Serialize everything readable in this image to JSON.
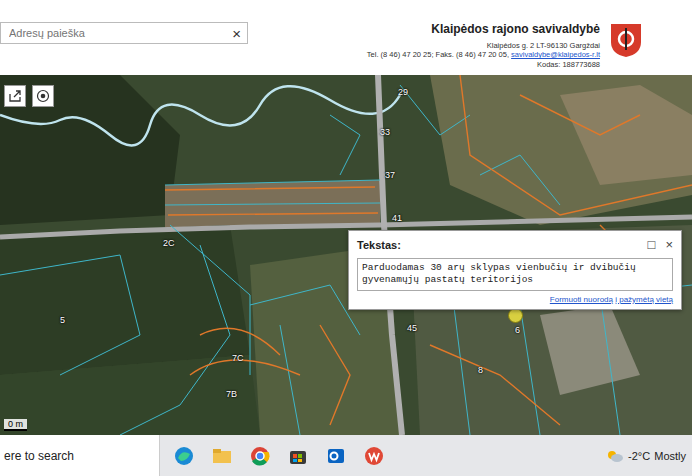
{
  "header": {
    "search": {
      "placeholder": "Adresų paieška",
      "clear": "×"
    },
    "org": {
      "name": "Klaipėdos rajono savivaldybė",
      "address": "Klaipėdos g. 2 LT-96130 Gargždai",
      "contacts": "Tel. (8 46) 47 20 25; Faks. (8 46) 47 20 05, ",
      "email": "savivaldybe@klaipedos-r.lt",
      "code": "Kodas: 188773688"
    }
  },
  "map": {
    "labels": [
      "29",
      "33",
      "37",
      "41",
      "2C",
      "45",
      "6",
      "8",
      "7C",
      "7B",
      "5"
    ],
    "scale": "0 m"
  },
  "popup": {
    "title": "Tekstas:",
    "maximize": "□",
    "close": "×",
    "text": "Parduodamas 30 arų sklypas vienbučių ir dvibučių gyvenamųjų pastatų teritorijos",
    "link": "Formuoti nuorodą į pažymėtą vietą"
  },
  "taskbar": {
    "search": "ere to search",
    "weather": {
      "temp": "-2°C",
      "desc": "Mostly"
    }
  }
}
